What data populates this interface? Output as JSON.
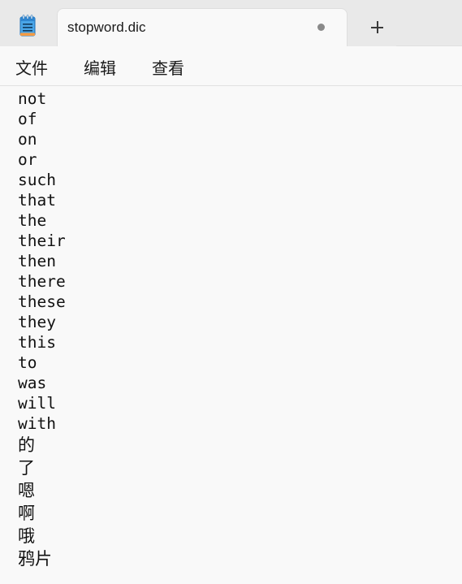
{
  "window": {
    "tab_title": "stopword.dic",
    "unsaved_indicator": "•",
    "new_tab": "+"
  },
  "menu": {
    "file": "文件",
    "edit": "编辑",
    "view": "查看"
  },
  "icons": {
    "app": "notepad-icon",
    "new_tab": "plus-icon",
    "unsaved": "dot-icon"
  },
  "editor": {
    "lines": [
      "not",
      "of",
      "on",
      "or",
      "such",
      "that",
      "the",
      "their",
      "then",
      "there",
      "these",
      "they",
      "this",
      "to",
      "was",
      "will",
      "with",
      "的",
      "了",
      "嗯",
      "啊",
      "哦",
      "鸦片"
    ]
  }
}
